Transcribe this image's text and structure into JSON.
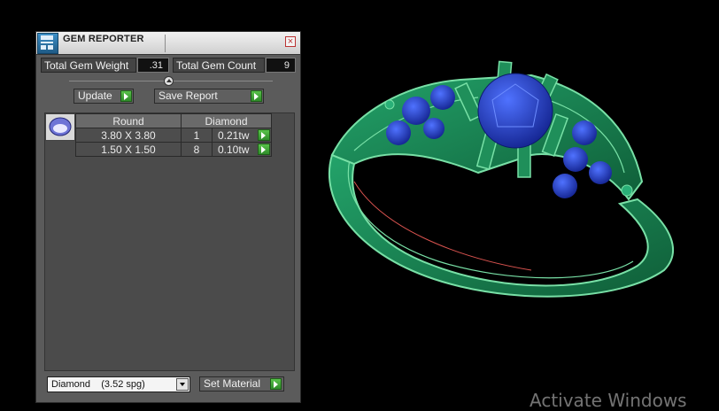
{
  "panel": {
    "title": "GEM REPORTER",
    "close_symbol": "×",
    "total_weight_label": "Total Gem Weight",
    "total_weight_value": ".31",
    "total_count_label": "Total Gem Count",
    "total_count_value": "9",
    "update_label": "Update",
    "save_report_label": "Save Report"
  },
  "table": {
    "columns": [
      "Round",
      "Diamond"
    ],
    "rows": [
      {
        "size": "3.80 X 3.80",
        "count": "1",
        "weight": "0.21tw"
      },
      {
        "size": "1.50 X 1.50",
        "count": "8",
        "weight": "0.10tw"
      }
    ]
  },
  "material": {
    "selected": "Diamond    (3.52 spg)",
    "set_label": "Set Material"
  },
  "watermark": "Activate Windows",
  "colors": {
    "metal": "#1e8f5a",
    "edges": "#78e0a6",
    "gem": "#1f3db8",
    "accent": "#3aa832"
  }
}
